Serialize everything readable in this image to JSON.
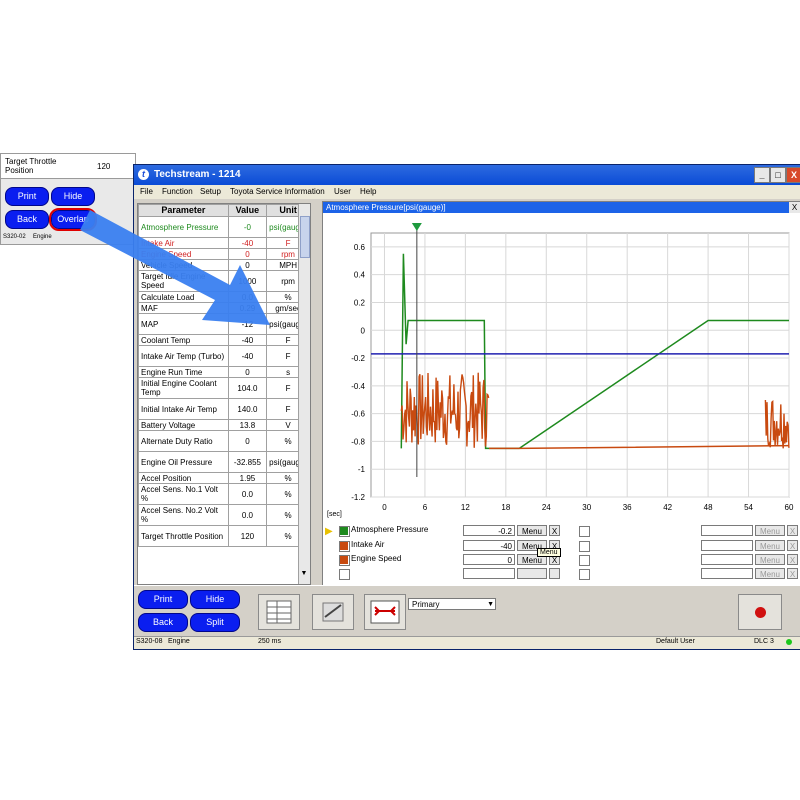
{
  "background": {
    "tt_label": "Target Throttle Position",
    "tt_value": "120",
    "buttons": [
      "Print",
      "Hide",
      "Back",
      "Overlap"
    ],
    "status": [
      "S320-02",
      "Engine"
    ]
  },
  "window": {
    "title": "Techstream - 1214",
    "menu": [
      "File",
      "Function",
      "Setup",
      "Toyota Service Information",
      "User",
      "Help"
    ],
    "controls": {
      "minimize": "_",
      "maximize": "□",
      "close": "X"
    }
  },
  "params": {
    "headers": [
      "Parameter",
      "Value",
      "Unit"
    ],
    "rows": [
      {
        "name": "Atmosphere Pressure",
        "value": "-0",
        "unit": "psi(gauge)"
      },
      {
        "name": "Intake Air",
        "value": "-40",
        "unit": "F"
      },
      {
        "name": "Engine Speed",
        "value": "0",
        "unit": "rpm"
      },
      {
        "name": "Vehicle Speed",
        "value": "0",
        "unit": "MPH"
      },
      {
        "name": "Target Idle Engine Speed",
        "value": "1000",
        "unit": "rpm"
      },
      {
        "name": "Calculate Load",
        "value": "0.0",
        "unit": "%"
      },
      {
        "name": "MAF",
        "value": "0.29",
        "unit": "gm/sec"
      },
      {
        "name": "MAP",
        "value": "-12",
        "unit": "psi(gauge)"
      },
      {
        "name": "Coolant Temp",
        "value": "-40",
        "unit": "F"
      },
      {
        "name": "Intake Air Temp (Turbo)",
        "value": "-40",
        "unit": "F"
      },
      {
        "name": "Engine Run Time",
        "value": "0",
        "unit": "s"
      },
      {
        "name": "Initial Engine Coolant Temp",
        "value": "104.0",
        "unit": "F"
      },
      {
        "name": "Initial Intake Air Temp",
        "value": "140.0",
        "unit": "F"
      },
      {
        "name": "Battery Voltage",
        "value": "13.8",
        "unit": "V"
      },
      {
        "name": "Alternate Duty Ratio",
        "value": "0",
        "unit": "%"
      },
      {
        "name": "Engine Oil Pressure",
        "value": "-32.855",
        "unit": "psi(gauge)"
      },
      {
        "name": "Accel Position",
        "value": "1.95",
        "unit": "%"
      },
      {
        "name": "Accel Sens. No.1 Volt %",
        "value": "0.0",
        "unit": "%"
      },
      {
        "name": "Accel Sens. No.2 Volt %",
        "value": "0.0",
        "unit": "%"
      },
      {
        "name": "Target Throttle Position",
        "value": "120",
        "unit": "%"
      }
    ]
  },
  "graph": {
    "title": "Atmosphere Pressure[psi(gauge)]",
    "close": "X",
    "sec_label": "[sec]",
    "legend": [
      {
        "name": "Atmosphere Pressure",
        "value": "-0.2",
        "menu": "Menu",
        "x": "X",
        "color": "#1e8a1e"
      },
      {
        "name": "Intake Air",
        "value": "-40",
        "menu": "Menu",
        "x": "X",
        "color": "#c84a10"
      },
      {
        "name": "Engine Speed",
        "value": "0",
        "menu": "Menu",
        "x": "X",
        "color": "#c84a10"
      }
    ],
    "tooltip": "Menu",
    "right_menu": [
      "Menu",
      "Menu",
      "Menu",
      "Menu"
    ]
  },
  "chart_data": {
    "type": "line",
    "x_ticks": [
      0,
      6,
      12,
      18,
      24,
      30,
      36,
      42,
      48,
      54,
      60
    ],
    "y_ticks": [
      0.6,
      0.4,
      0.2,
      0,
      -0.2,
      -0.4,
      -0.6,
      -0.8,
      -1,
      -1.2
    ],
    "xlim": [
      -2,
      60
    ],
    "ylim": [
      -1.2,
      0.7
    ],
    "grid": true,
    "series": [
      {
        "color": "#1e8a1e",
        "points": [
          [
            2.5,
            -0.85
          ],
          [
            2.8,
            0.55
          ],
          [
            3.2,
            -0.1
          ],
          [
            3.5,
            0.07
          ],
          [
            14.8,
            0.07
          ],
          [
            15,
            -0.85
          ],
          [
            20,
            -0.85
          ],
          [
            48,
            0.07
          ],
          [
            60,
            0.07
          ]
        ]
      },
      {
        "color": "#2020b0",
        "points": [
          [
            -2,
            -0.17
          ],
          [
            60,
            -0.17
          ]
        ]
      },
      {
        "color": "#c84a10",
        "noise": [
          [
            2.5,
            15.5,
            -0.85,
            -0.3
          ],
          [
            56.5,
            60,
            -0.85,
            -0.45
          ]
        ],
        "points": [
          [
            15.5,
            -0.85
          ],
          [
            20,
            -0.85
          ],
          [
            60,
            -0.83
          ]
        ]
      }
    ],
    "cursor_x": 4.8
  },
  "toolbar": {
    "buttons": [
      "Print",
      "Hide",
      "Back",
      "Split"
    ],
    "select_value": "Primary",
    "record_color": "#d01010"
  },
  "status": {
    "left": "S320-08",
    "mid": "Engine",
    "rate": "250 ms",
    "user": "Default User",
    "dlc": "DLC 3"
  }
}
